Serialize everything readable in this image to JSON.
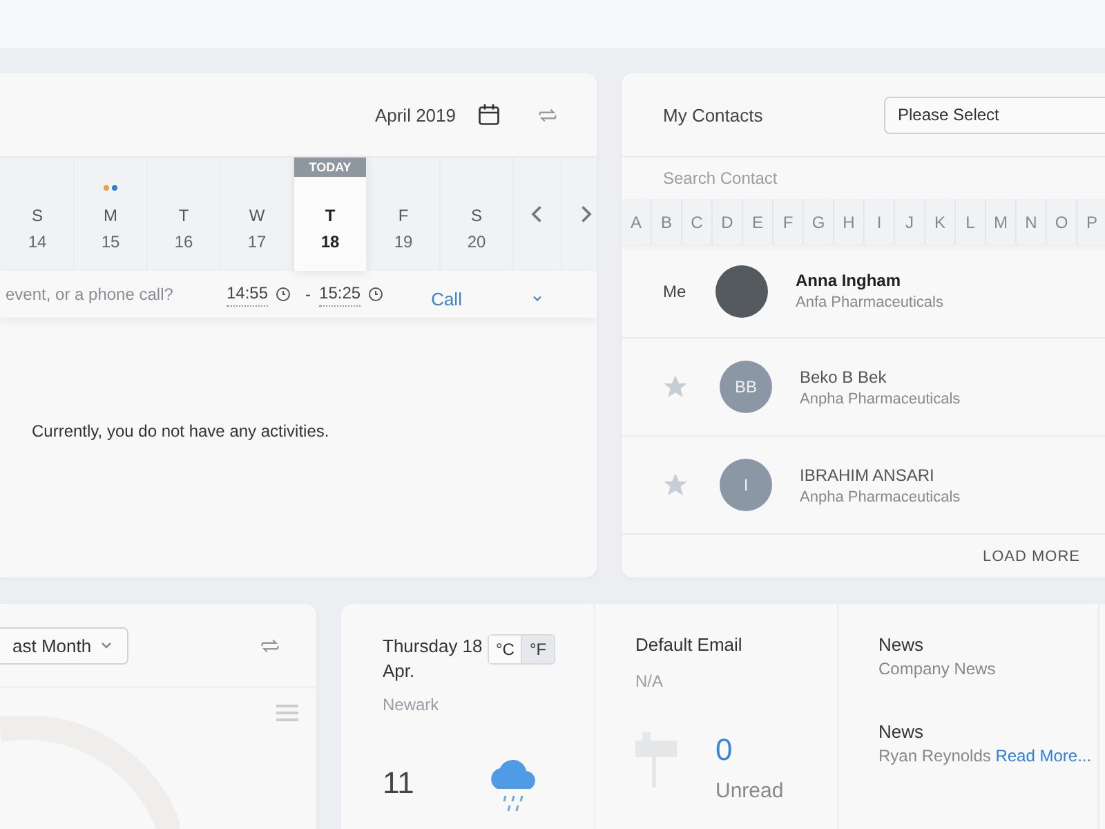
{
  "calendar": {
    "month": "April 2019",
    "today_label": "TODAY",
    "days": [
      {
        "weekday": "S",
        "date": "14",
        "today": false
      },
      {
        "weekday": "M",
        "date": "15",
        "today": false,
        "dots": [
          {
            "color": "#e8a33d"
          },
          {
            "color": "#2f7fd8"
          }
        ]
      },
      {
        "weekday": "T",
        "date": "16",
        "today": false
      },
      {
        "weekday": "W",
        "date": "17",
        "today": false
      },
      {
        "weekday": "T",
        "date": "18",
        "today": true
      },
      {
        "weekday": "F",
        "date": "19",
        "today": false
      },
      {
        "weekday": "S",
        "date": "20",
        "today": false
      }
    ],
    "event_form": {
      "placeholder": "event, or a phone call?",
      "start": "14:55",
      "separator": "-",
      "end": "15:25",
      "type": "Call"
    },
    "empty_message": "Currently, you do not have any activities."
  },
  "contacts": {
    "title": "My Contacts",
    "filter": "Please Select",
    "search_placeholder": "Search Contact",
    "letters": [
      "A",
      "B",
      "C",
      "D",
      "E",
      "F",
      "G",
      "H",
      "I",
      "J",
      "K",
      "L",
      "M",
      "N",
      "O",
      "P"
    ],
    "people": [
      {
        "kind": "me",
        "label": "Me",
        "name": "Anna Ingham",
        "company": "Anfa Pharmaceuticals"
      },
      {
        "kind": "contact",
        "favorite": false,
        "initials": "BB",
        "name": "Beko B Bek",
        "company": "Anpha Pharmaceuticals"
      },
      {
        "kind": "contact",
        "favorite": false,
        "initials": "I",
        "name": "IBRAHIM ANSARI",
        "company": "Anpha Pharmaceuticals"
      }
    ],
    "load_more": "LOAD MORE"
  },
  "activity": {
    "period": "ast Month"
  },
  "weather": {
    "date": "Thursday 18 Apr.",
    "units": [
      {
        "label": "°C",
        "selected": false
      },
      {
        "label": "°F",
        "selected": true
      }
    ],
    "city": "Newark",
    "temperature": "11"
  },
  "email": {
    "title": "Default Email",
    "address": "N/A",
    "count": "0",
    "count_label": "Unread"
  },
  "news": [
    {
      "title": "News",
      "text": "Company News"
    },
    {
      "title": "News",
      "text": "Ryan Reynolds",
      "link": "Read More..."
    }
  ]
}
